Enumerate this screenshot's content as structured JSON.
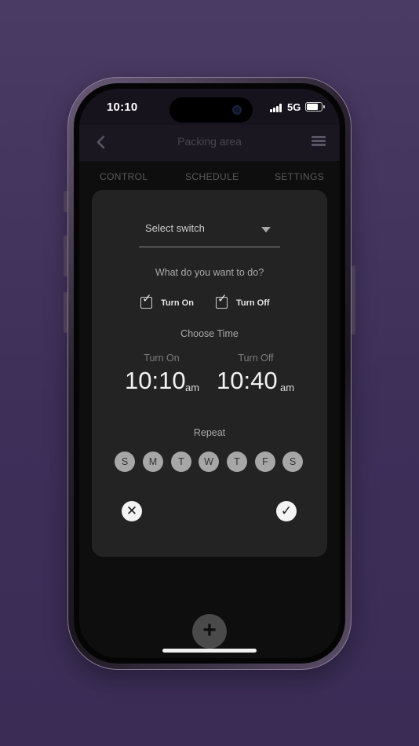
{
  "status_bar": {
    "time": "10:10",
    "network": "5G",
    "battery_level": 0.8
  },
  "app_bar": {
    "title": "Packing area",
    "back_icon": "chevron-left-icon",
    "menu_icon": "hamburger-menu-icon"
  },
  "tabs": [
    {
      "label": "CONTROL"
    },
    {
      "label": "SCHEDULE"
    },
    {
      "label": "SETTINGS"
    }
  ],
  "schedule_card": {
    "select_switch": {
      "placeholder": "Select switch",
      "selected_value": ""
    },
    "question": "What do you want to do?",
    "actions": {
      "turn_on": {
        "label": "Turn On",
        "checked": true
      },
      "turn_off": {
        "label": "Turn Off",
        "checked": true
      }
    },
    "choose_time_label": "Choose Time",
    "turn_on_time": {
      "label": "Turn On",
      "time": "10:10",
      "period": "am"
    },
    "turn_off_time": {
      "label": "Turn Off",
      "time": "10:40",
      "period": "am"
    },
    "repeat_label": "Repeat",
    "days": [
      "S",
      "M",
      "T",
      "W",
      "T",
      "F",
      "S"
    ],
    "cancel_icon": "close-icon",
    "confirm_icon": "checkmark-icon"
  },
  "fab": {
    "icon": "plus-icon"
  },
  "colors": {
    "background": "#3f3158",
    "screen": "#0e0e0e",
    "card": "#232323",
    "day_chip": "#a7a7a7"
  }
}
